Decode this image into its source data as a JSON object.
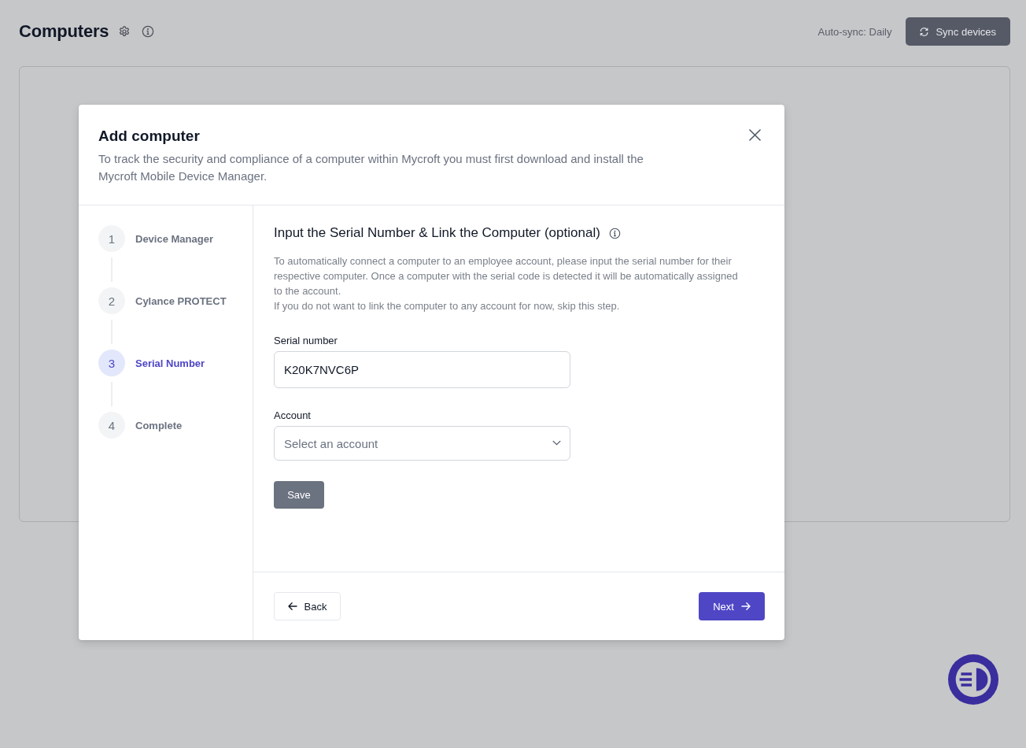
{
  "page": {
    "title": "Computers",
    "auto_sync": "Auto-sync: Daily",
    "sync_button": "Sync devices"
  },
  "modal": {
    "title": "Add computer",
    "description": "To track the security and compliance of a computer within Mycroft you must first download and install the Mycroft Mobile Device Manager.",
    "steps": [
      {
        "number": "1",
        "label": "Device Manager",
        "selected": false
      },
      {
        "number": "2",
        "label": "Cylance PROTECT",
        "selected": false
      },
      {
        "number": "3",
        "label": "Serial Number",
        "selected": true
      },
      {
        "number": "4",
        "label": "Complete",
        "selected": false
      }
    ],
    "section": {
      "title": "Input the Serial Number & Link the Computer (optional)",
      "paragraphs": [
        "To automatically connect a computer to an employee account, please input the serial number for their respective computer. Once a computer with the serial code is detected it will be automatically assigned to the account.",
        "If you do not want to link the computer to any account for now, skip this step."
      ],
      "fields": [
        {
          "kind": "text",
          "label": "Serial number",
          "value": "K20K7NVC6P"
        },
        {
          "kind": "select",
          "label": "Account",
          "placeholder": "Select an account"
        }
      ],
      "save_button": "Save"
    },
    "back_button": "Back",
    "next_button": "Next"
  }
}
